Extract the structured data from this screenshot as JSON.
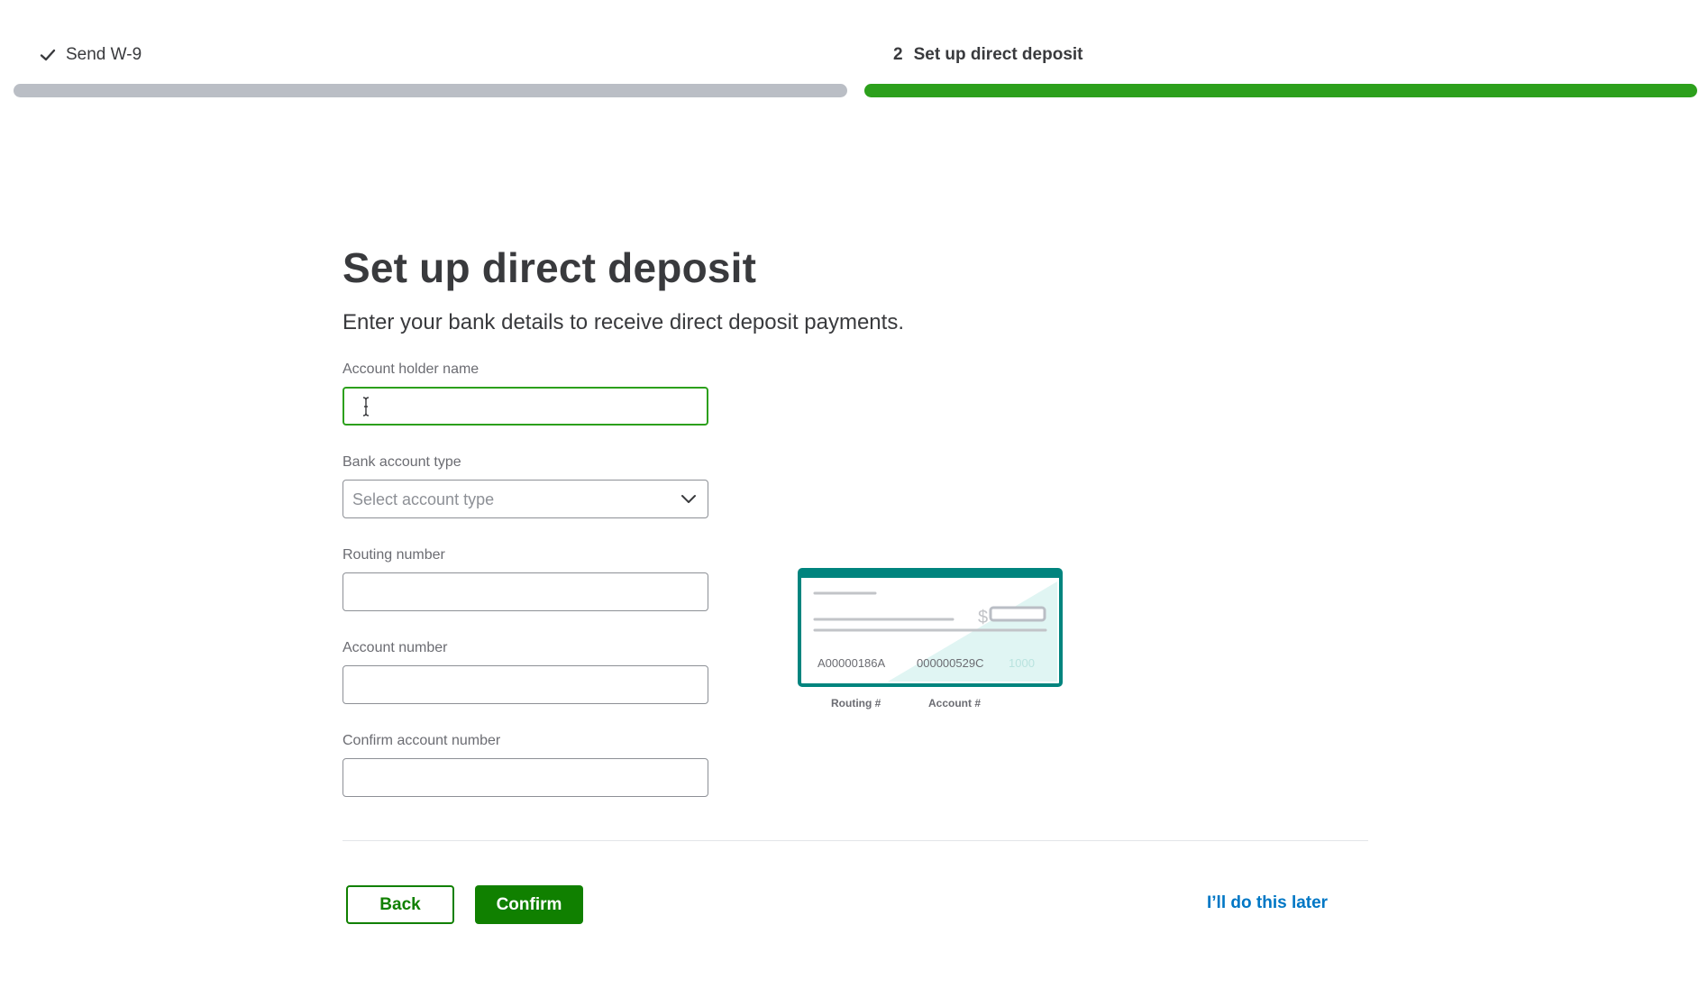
{
  "stepper": {
    "steps": [
      {
        "label": "Send W-9",
        "status": "complete",
        "marker": "check-icon"
      },
      {
        "number": "2",
        "label": "Set up direct deposit",
        "status": "active"
      }
    ],
    "colors": {
      "complete_bar": "#babec5",
      "active_bar": "#2ca01c"
    }
  },
  "header": {
    "title": "Set up direct deposit",
    "subtitle": "Enter your bank details to receive direct deposit payments."
  },
  "form": {
    "account_holder_name": {
      "label": "Account holder name",
      "value": "",
      "focused": true
    },
    "bank_account_type": {
      "label": "Bank account type",
      "placeholder": "Select account type"
    },
    "routing_number": {
      "label": "Routing number",
      "value": ""
    },
    "account_number": {
      "label": "Account number",
      "value": ""
    },
    "confirm_account_number": {
      "label": "Confirm account number",
      "value": ""
    }
  },
  "cheque_illustration": {
    "currency_symbol": "$",
    "routing_sample": "A00000186A",
    "account_sample": "000000529C",
    "check_number_sample": "1000",
    "routing_caption": "Routing #",
    "account_caption": "Account #",
    "colors": {
      "frame": "#00847e",
      "fill": "#e0f5f3"
    }
  },
  "actions": {
    "back_label": "Back",
    "confirm_label": "Confirm",
    "later_label": "I’ll do this later"
  },
  "colors": {
    "primary_green": "#108000",
    "focus_green": "#2ca01c",
    "link_blue": "#0077c5"
  }
}
